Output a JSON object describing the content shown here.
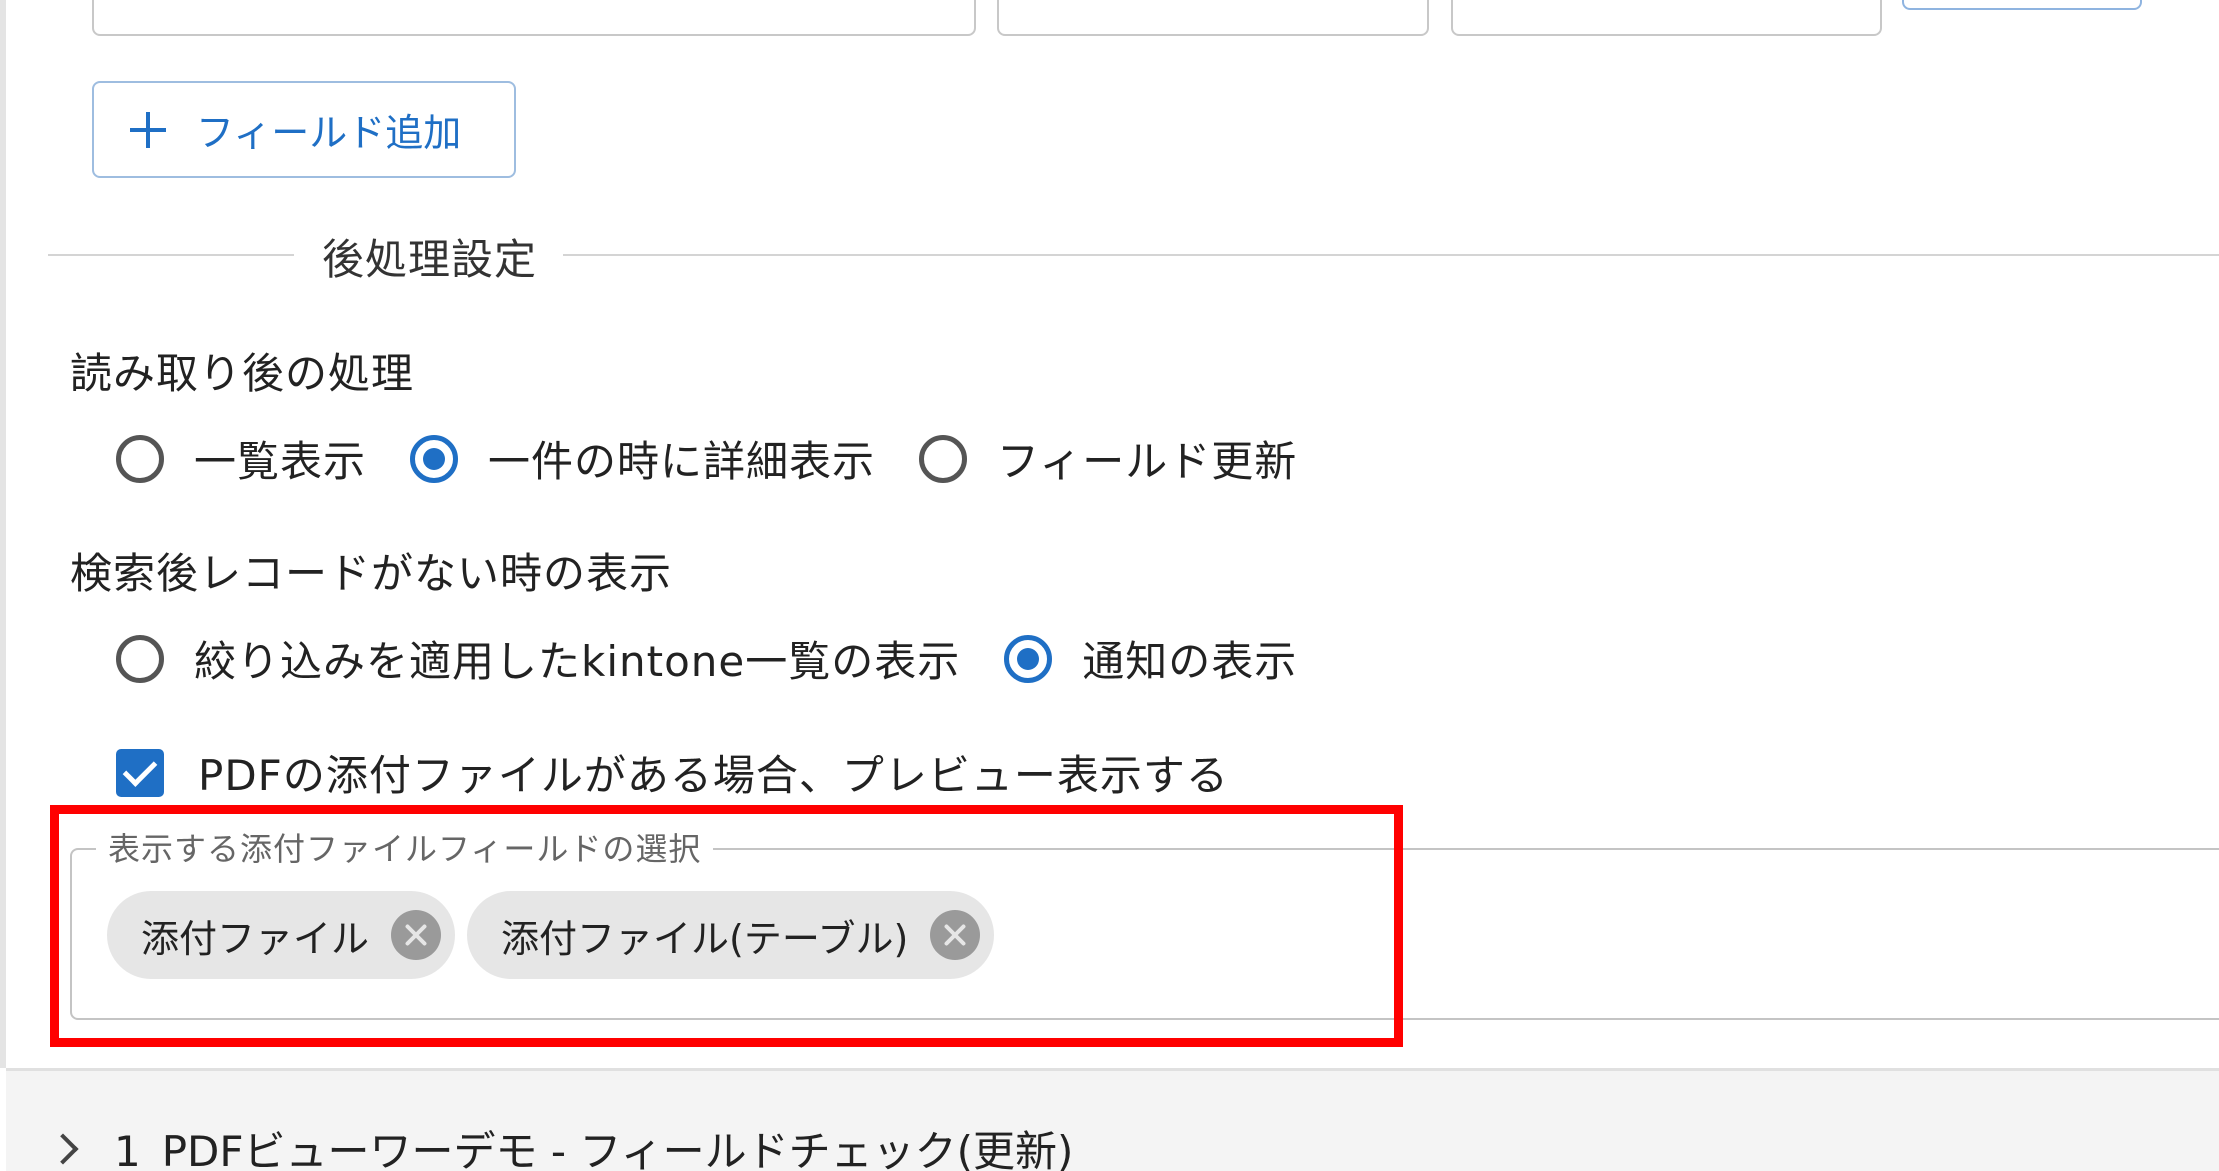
{
  "add_field_button": {
    "label": "フィールド追加"
  },
  "post_processing": {
    "section_title": "後処理設定",
    "after_read": {
      "label": "読み取り後の処理",
      "options": [
        {
          "label": "一覧表示",
          "checked": false
        },
        {
          "label": "一件の時に詳細表示",
          "checked": true
        },
        {
          "label": "フィールド更新",
          "checked": false
        }
      ]
    },
    "no_record": {
      "label": "検索後レコードがない時の表示",
      "options": [
        {
          "label": "絞り込みを適用したkintone一覧の表示",
          "checked": false
        },
        {
          "label": "通知の表示",
          "checked": true
        }
      ]
    },
    "pdf_preview": {
      "label": "PDFの添付ファイルがある場合、プレビュー表示する",
      "checked": true
    },
    "attachment_select": {
      "legend": "表示する添付ファイルフィールドの選択",
      "chips": [
        {
          "label": "添付ファイル"
        },
        {
          "label": "添付ファイル(テーブル)"
        }
      ]
    }
  },
  "collapsed_panel": {
    "title": "1_PDFビューワーデモ - フィールドチェック(更新)"
  },
  "colors": {
    "accent": "#1f6fc5",
    "highlight": "#ff0000"
  }
}
